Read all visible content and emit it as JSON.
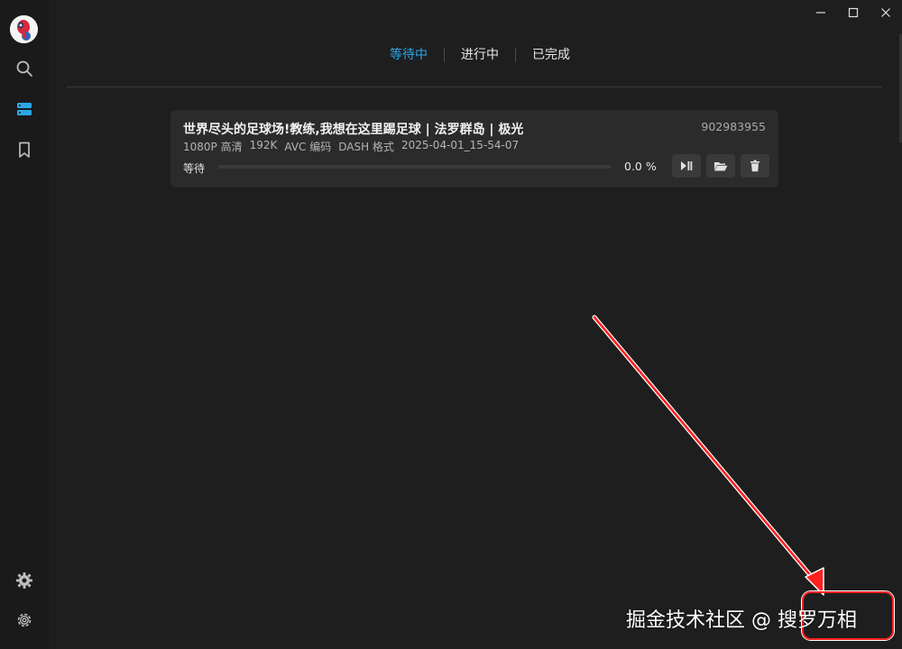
{
  "window": {
    "controls": [
      "minimize-icon",
      "maximize-icon",
      "close-icon"
    ]
  },
  "sidebar": {
    "icons": [
      "search-icon",
      "download-list-icon",
      "bookmark-icon",
      "gear-alt-icon",
      "gear-icon"
    ],
    "accent": "#2ba7e6"
  },
  "tabs": [
    {
      "label": "等待中",
      "active": true
    },
    {
      "label": "进行中",
      "active": false
    },
    {
      "label": "已完成",
      "active": false
    }
  ],
  "task": {
    "title": "世界尽头的足球场!教练,我想在这里踢足球 | 法罗群岛 | 极光",
    "id": "902983955",
    "meta": [
      "1080P 高清",
      "192K",
      "AVC 编码",
      "DASH 格式",
      "2025-04-01_15-54-07"
    ],
    "status": "等待",
    "progress": 0.0,
    "progress_text": "0.0 %",
    "buttons": [
      "play-pause-icon",
      "folder-open-icon",
      "delete-icon"
    ]
  },
  "annotation": {
    "watermark": "掘金技术社区 @ 搜罗万相",
    "color": "#ff2020"
  }
}
